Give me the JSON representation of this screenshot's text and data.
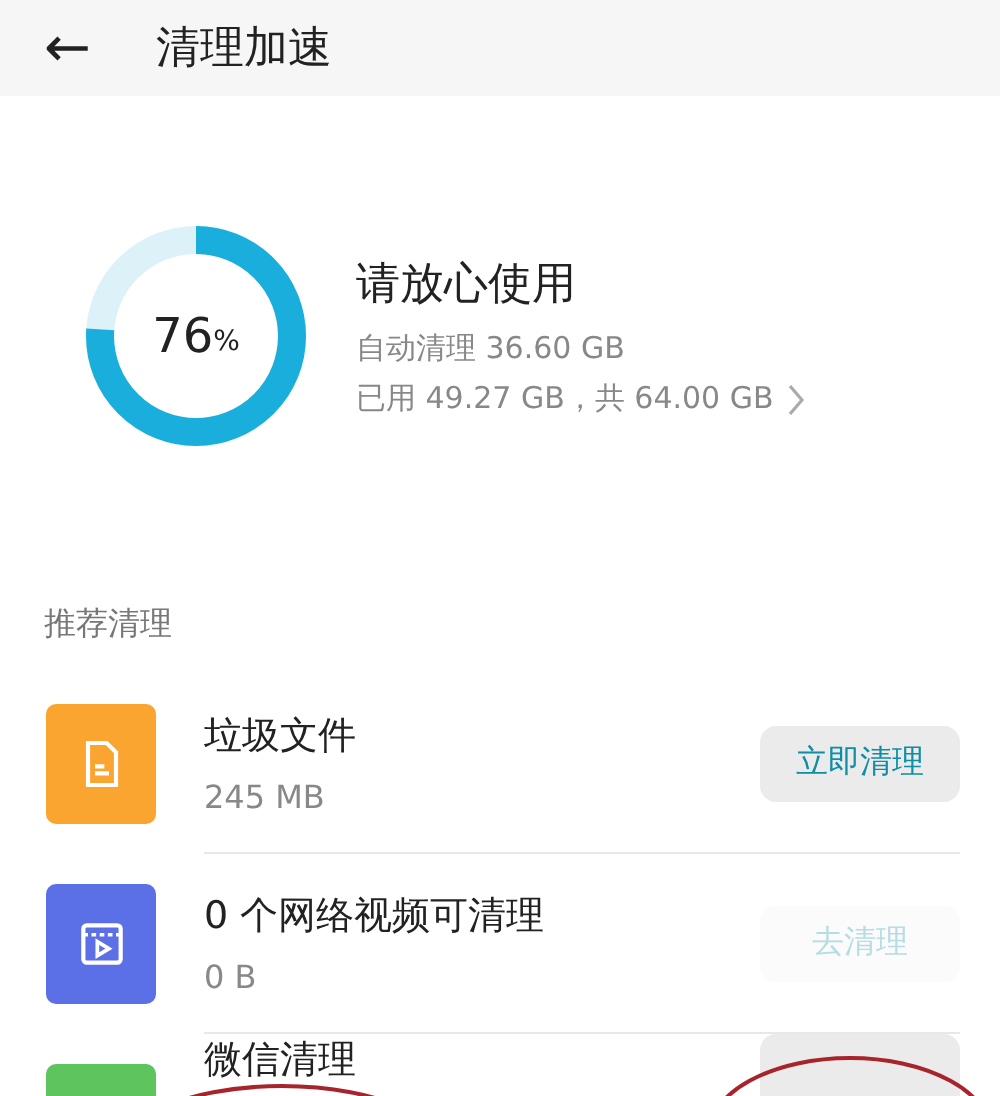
{
  "header": {
    "back_icon": "←",
    "title": "清理加速"
  },
  "storage": {
    "level": 0.76,
    "percent": "76",
    "percent_sign": "%",
    "status": "请放心使用",
    "auto_clean": "自动清理 36.60 GB",
    "usage": "已用 49.27 GB，共 64.00 GB"
  },
  "section_title": "推荐清理",
  "items": [
    {
      "kind": "file",
      "color": "#f9a530",
      "title": "垃圾文件",
      "size": "245 MB",
      "button": {
        "label": "立即清理",
        "disabled": false
      }
    },
    {
      "kind": "video",
      "color": "#5b6fe6",
      "title": "0 个网络视频可清理",
      "size": "0 B",
      "button": {
        "label": "去清理",
        "disabled": true
      }
    },
    {
      "kind": "chat",
      "color": "#5ec45d",
      "title": "微信清理",
      "button": {
        "disabled": false
      }
    }
  ]
}
